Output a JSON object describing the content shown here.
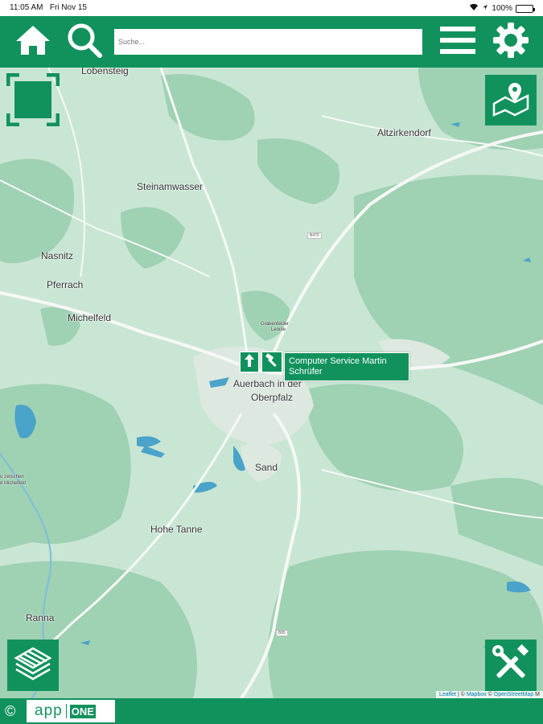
{
  "status_bar": {
    "time": "11:05 AM",
    "date": "Fri Nov 15",
    "battery": "100%"
  },
  "header": {
    "search": {
      "placeholder": "Suche..."
    },
    "icons": [
      "home-icon",
      "search-icon",
      "menu-icon",
      "settings-icon"
    ]
  },
  "map": {
    "places": [
      {
        "name": "Lobensteig"
      },
      {
        "name": "Altzirkendorf"
      },
      {
        "name": "Steinamwasser"
      },
      {
        "name": "Nasnitz"
      },
      {
        "name": "Pferrach"
      },
      {
        "name": "Michelfeld"
      },
      {
        "name": "Auerbach in der"
      },
      {
        "name": "Oberpfalz"
      },
      {
        "name": "Sand"
      },
      {
        "name": "Hohe Tanne"
      },
      {
        "name": "Ranna"
      },
      {
        "name": "Grabenfelder"
      },
      {
        "name": "Leonie"
      },
      {
        "name": "u zwischen"
      },
      {
        "name": "d Michelfeld"
      }
    ],
    "roads": [
      "B470",
      "B85"
    ],
    "popup": {
      "title": "Computer Service Martin Schrüfer"
    },
    "attribution": {
      "leaflet": "Leaflet",
      "sep1": " | © ",
      "mapbox": "Mapbox",
      "sep2": " © ",
      "osm": "OpenStreetMap",
      "rest": " M"
    },
    "buttons": [
      "fullscreen-icon",
      "location-map-icon",
      "layers-icon",
      "tools-icon"
    ]
  },
  "footer": {
    "copyright": "©",
    "logo_app": "app",
    "logo_one": "ONE"
  },
  "colors": {
    "brand": "#11925d",
    "map_base": "#c9e6d4",
    "forest": "#9fd1b3",
    "water": "#4aa3c9"
  }
}
